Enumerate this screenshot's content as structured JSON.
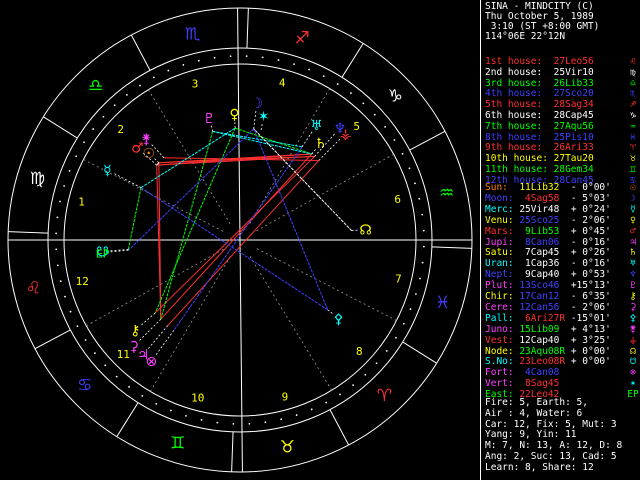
{
  "header": {
    "name": "SINA - MINDCITY (C)",
    "date": "Thu October 5, 1989",
    "time": " 3:10 (ST +8:00 GMT)",
    "location": "114°06E 22°12N"
  },
  "colors": {
    "background": "#000000",
    "wheel_line": "#ffffff",
    "house_line": "#aaaaaa",
    "red": "#ff3030",
    "yellow": "#ffff00",
    "green": "#00ff00",
    "cyan": "#00ffff",
    "blue": "#4040ff",
    "magenta": "#ff40ff",
    "orange": "#ff8000",
    "lime": "#80ff40"
  },
  "houses": [
    {
      "label": "1st house:",
      "value": "27Leo56",
      "color": "#ff3030",
      "glyph": "♌"
    },
    {
      "label": "2nd house:",
      "value": "25Vir10",
      "color": "#ffffff",
      "glyph": "♍"
    },
    {
      "label": "3rd house:",
      "value": "26Lib33",
      "color": "#00ff00",
      "glyph": "♎"
    },
    {
      "label": "4th house:",
      "value": "27Sco20",
      "color": "#4040ff",
      "glyph": "♏"
    },
    {
      "label": "5th house:",
      "value": "28Sag34",
      "color": "#ff3030",
      "glyph": "♐"
    },
    {
      "label": "6th house:",
      "value": "28Cap45",
      "color": "#ffffff",
      "glyph": "♑"
    },
    {
      "label": "7th house:",
      "value": "27Aqu56",
      "color": "#00ff00",
      "glyph": "♒"
    },
    {
      "label": "8th house:",
      "value": "25Pis10",
      "color": "#4040ff",
      "glyph": "♓"
    },
    {
      "label": "9th house:",
      "value": "26Ari33",
      "color": "#ff3030",
      "glyph": "♈"
    },
    {
      "label": "10th house:",
      "value": "27Tau20",
      "color": "#ffff00",
      "glyph": "♉"
    },
    {
      "label": "11th house:",
      "value": "28Gem34",
      "color": "#00ff00",
      "glyph": "♊"
    },
    {
      "label": "12th house:",
      "value": "28Can45",
      "color": "#4040ff",
      "glyph": "♋"
    }
  ],
  "planets": [
    {
      "name": "Sun:",
      "pos": "11Lib32",
      "motion": "- 0°00'",
      "name_color": "#ff8000",
      "pos_color": "#ffff00",
      "glyph": "☉",
      "glyph_color": "#ff8000"
    },
    {
      "name": "Moon:",
      "pos": " 4Sag58",
      "motion": "- 5°03'",
      "name_color": "#4040ff",
      "pos_color": "#ff3030",
      "glyph": "☽",
      "glyph_color": "#4040ff"
    },
    {
      "name": "Merc:",
      "pos": "25Vir48",
      "motion": "+ 0°24'",
      "name_color": "#00ffff",
      "pos_color": "#ffffff",
      "glyph": "☿",
      "glyph_color": "#00ffff"
    },
    {
      "name": "Venu:",
      "pos": "25Sco25",
      "motion": "- 2°06'",
      "name_color": "#ffff00",
      "pos_color": "#4040ff",
      "glyph": "♀",
      "glyph_color": "#ffff00"
    },
    {
      "name": "Mars:",
      "pos": " 9Lib53",
      "motion": "+ 0°45'",
      "name_color": "#ff3030",
      "pos_color": "#00ff00",
      "glyph": "♂",
      "glyph_color": "#ff3030"
    },
    {
      "name": "Jupi:",
      "pos": " 8Can06",
      "motion": "- 0°16'",
      "name_color": "#ff40ff",
      "pos_color": "#4040ff",
      "glyph": "♃",
      "glyph_color": "#ff40ff"
    },
    {
      "name": "Satu:",
      "pos": " 7Cap45",
      "motion": "+ 0°26'",
      "name_color": "#ffff00",
      "pos_color": "#ffffff",
      "glyph": "♄",
      "glyph_color": "#ffff00"
    },
    {
      "name": "Uran:",
      "pos": " 1Cap36",
      "motion": "- 0°16'",
      "name_color": "#00ffff",
      "pos_color": "#ffffff",
      "glyph": "♅",
      "glyph_color": "#00ffff"
    },
    {
      "name": "Nept:",
      "pos": " 9Cap40",
      "motion": "+ 0°53'",
      "name_color": "#4040ff",
      "pos_color": "#ffffff",
      "glyph": "♆",
      "glyph_color": "#4040ff"
    },
    {
      "name": "Plut:",
      "pos": "13Sco46",
      "motion": "+15°13'",
      "name_color": "#ff40ff",
      "pos_color": "#4040ff",
      "glyph": "♇",
      "glyph_color": "#ff40ff"
    },
    {
      "name": "Chir:",
      "pos": "17Can12",
      "motion": "- 6°35'",
      "name_color": "#ffff00",
      "pos_color": "#4040ff",
      "glyph": "⚷",
      "glyph_color": "#ffff00"
    },
    {
      "name": "Cere:",
      "pos": "12Can56",
      "motion": "- 2°06'",
      "name_color": "#ff40ff",
      "pos_color": "#4040ff",
      "glyph": "⚳",
      "glyph_color": "#ff40ff"
    },
    {
      "name": "Pall:",
      "pos": " 6Ari27R",
      "motion": "-15°01'",
      "name_color": "#00ffff",
      "pos_color": "#ff3030",
      "glyph": "⚴",
      "glyph_color": "#00ffff"
    },
    {
      "name": "Juno:",
      "pos": "15Lib09",
      "motion": "+ 4°13'",
      "name_color": "#ff40ff",
      "pos_color": "#00ff00",
      "glyph": "⚵",
      "glyph_color": "#ff40ff"
    },
    {
      "name": "Vest:",
      "pos": "12Cap40",
      "motion": "+ 3°25'",
      "name_color": "#ff3030",
      "pos_color": "#ffffff",
      "glyph": "⚶",
      "glyph_color": "#ff3030"
    },
    {
      "name": "Node:",
      "pos": "23Aqu08R",
      "motion": "+ 0°00'",
      "name_color": "#ffff00",
      "pos_color": "#00ff00",
      "glyph": "☊",
      "glyph_color": "#ffff00"
    },
    {
      "name": "S.No:",
      "pos": "23Leo08R",
      "motion": "+ 0°00'",
      "name_color": "#00ffff",
      "pos_color": "#ff3030",
      "glyph": "☋",
      "glyph_color": "#00ffff"
    },
    {
      "name": "Fort:",
      "pos": " 4Can08",
      "motion": "",
      "name_color": "#ff40ff",
      "pos_color": "#4040ff",
      "glyph": "⊗",
      "glyph_color": "#ff40ff"
    },
    {
      "name": "Vert:",
      "pos": " 8Sag45",
      "motion": "",
      "name_color": "#ff40ff",
      "pos_color": "#ff3030",
      "glyph": "✶",
      "glyph_color": "#00ffff"
    },
    {
      "name": "East:",
      "pos": "22Leo42",
      "motion": "",
      "name_color": "#00ff00",
      "pos_color": "#ff3030",
      "glyph": "EP",
      "glyph_color": "#00ff00"
    }
  ],
  "summary": [
    "Fire: 5, Earth: 5,",
    "Air : 4, Water: 6",
    "Car: 12, Fix: 5, Mut: 3",
    "Yang: 9, Yin: 11",
    "M: 7, N: 13, A: 12, D: 8",
    "Ang: 2, Suc: 13, Cad: 5",
    "Learn: 8, Share: 12"
  ],
  "wheel": {
    "ascendant_deg": 147.93,
    "sign_glyphs": [
      "♈",
      "♉",
      "♊",
      "♋",
      "♌",
      "♍",
      "♎",
      "♏",
      "♐",
      "♑",
      "♒",
      "♓"
    ],
    "sign_colors": [
      "#ff3030",
      "#ffff00",
      "#00ff00",
      "#4040ff",
      "#ff3030",
      "#ffffff",
      "#00ff00",
      "#4040ff",
      "#ff3030",
      "#ffffff",
      "#00ff00",
      "#4040ff"
    ],
    "house_numbers": [
      "1",
      "2",
      "3",
      "4",
      "5",
      "6",
      "7",
      "8",
      "9",
      "10",
      "11",
      "12"
    ],
    "house_cusps_deg": [
      147.93,
      175.17,
      206.55,
      237.33,
      268.57,
      298.75,
      327.93,
      355.17,
      26.55,
      57.33,
      88.57,
      118.75
    ],
    "planet_positions_deg": [
      191.53,
      244.97,
      175.8,
      235.42,
      189.88,
      98.1,
      277.75,
      271.6,
      279.67,
      223.77,
      107.2,
      102.93,
      6.45,
      195.15,
      282.67,
      323.13,
      143.13,
      94.13,
      248.75,
      142.7
    ]
  },
  "aspects": [
    {
      "from": 0,
      "to": 6,
      "color": "#ff3030"
    },
    {
      "from": 0,
      "to": 8,
      "color": "#ff3030"
    },
    {
      "from": 4,
      "to": 6,
      "color": "#ff3030"
    },
    {
      "from": 4,
      "to": 8,
      "color": "#ff3030"
    },
    {
      "from": 13,
      "to": 14,
      "color": "#ff3030"
    },
    {
      "from": 0,
      "to": 11,
      "color": "#ff3030"
    },
    {
      "from": 4,
      "to": 11,
      "color": "#ff3030"
    },
    {
      "from": 6,
      "to": 11,
      "color": "#ff3030"
    },
    {
      "from": 8,
      "to": 10,
      "color": "#ff3030"
    },
    {
      "from": 5,
      "to": 14,
      "color": "#ff3030"
    },
    {
      "from": 2,
      "to": 16,
      "color": "#00ff00"
    },
    {
      "from": 3,
      "to": 10,
      "color": "#00ff00"
    },
    {
      "from": 9,
      "to": 11,
      "color": "#00ff00"
    },
    {
      "from": 3,
      "to": 6,
      "color": "#00ff00"
    },
    {
      "from": 1,
      "to": 12,
      "color": "#4040ff"
    },
    {
      "from": 1,
      "to": 19,
      "color": "#4040ff"
    },
    {
      "from": 12,
      "to": 2,
      "color": "#4040ff"
    },
    {
      "from": 7,
      "to": 17,
      "color": "#4040ff"
    },
    {
      "from": 2,
      "to": 3,
      "color": "#00ffff"
    },
    {
      "from": 9,
      "to": 6,
      "color": "#00ffff"
    },
    {
      "from": 7,
      "to": 9,
      "color": "#00ffff"
    },
    {
      "from": 0,
      "to": 4,
      "color": "#ffffff"
    },
    {
      "from": 15,
      "to": 1,
      "color": "#ffffff"
    }
  ]
}
